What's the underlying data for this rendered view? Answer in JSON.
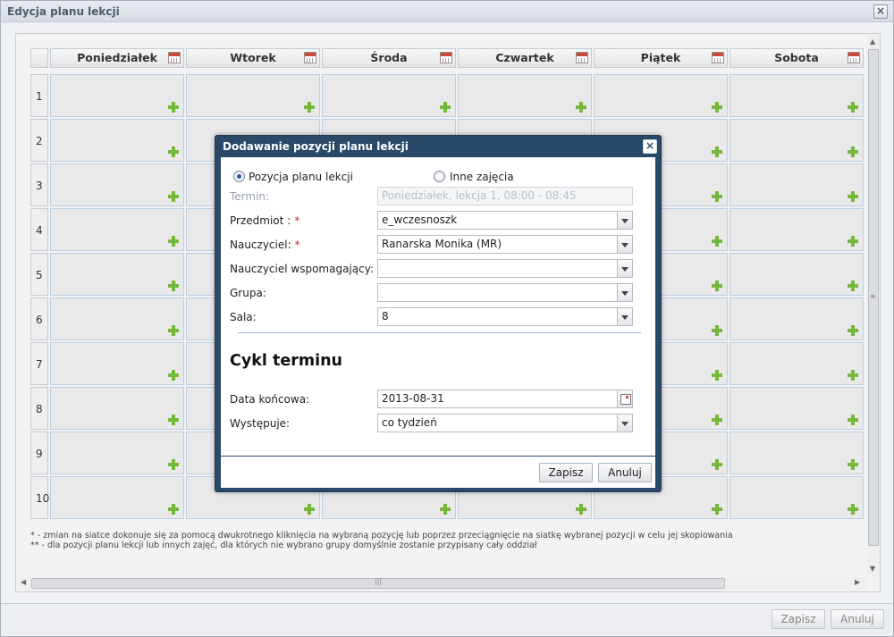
{
  "window": {
    "title": "Edycja planu lekcji"
  },
  "grid": {
    "days": [
      "Poniedziałek",
      "Wtorek",
      "Środa",
      "Czwartek",
      "Piątek",
      "Sobota"
    ],
    "rows": [
      "1",
      "2",
      "3",
      "4",
      "5",
      "6",
      "7",
      "8",
      "9",
      "10"
    ]
  },
  "notes": [
    "* - zmian na siatce dokonuje się za pomocą dwukrotnego kliknięcia na wybraną pozycję lub poprzez przeciągnięcie na siatkę wybranej pozycji w celu jej skopiowania",
    "** - dla pozycji planu lekcji lub innych zajęć, dla których nie wybrano grupy domyślnie zostanie przypisany cały oddział"
  ],
  "footer": {
    "save_label": "Zapisz",
    "cancel_label": "Anuluj"
  },
  "dialog": {
    "title": "Dodawanie pozycji planu lekcji",
    "radio_lesson": "Pozycja planu lekcji",
    "radio_other": "Inne zajęcia",
    "term_label": "Termin:",
    "term_value": "Poniedziałek, lekcja 1, 08:00 - 08:45",
    "subject_label": "Przedmiot :",
    "subject_value": "e_wczesnoszk",
    "teacher_label": "Nauczyciel:",
    "teacher_value": "Ranarska Monika (MR)",
    "assist_label": "Nauczyciel wspomagający:",
    "assist_value": "",
    "group_label": "Grupa:",
    "group_value": "",
    "room_label": "Sala:",
    "room_value": "8",
    "required_mark": "*",
    "section_title": "Cykl terminu",
    "end_date_label": "Data końcowa:",
    "end_date_value": "2013-08-31",
    "occurs_label": "Występuje:",
    "occurs_value": "co tydzień",
    "save_label": "Zapisz",
    "cancel_label": "Anuluj"
  },
  "colors": {
    "dialog_frame": "#2a4867",
    "plus": "#76b83c",
    "required": "#d0202a"
  }
}
